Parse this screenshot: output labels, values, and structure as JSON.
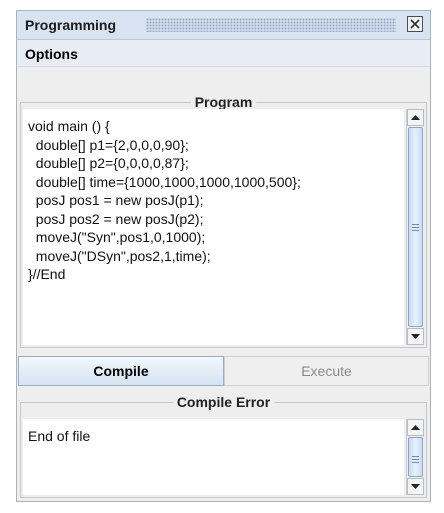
{
  "window": {
    "title": "Programming"
  },
  "menubar": {
    "items": [
      "Options"
    ]
  },
  "program": {
    "group_title": "Program",
    "code": "void main () {\n  double[] p1={2,0,0,0,90};\n  double[] p2={0,0,0,0,87};\n  double[] time={1000,1000,1000,1000,500};\n  posJ pos1 = new posJ(p1);\n  posJ pos2 = new posJ(p2);\n  moveJ(\"Syn\",pos1,0,1000);\n  moveJ(\"DSyn\",pos2,1,time);\n}//End"
  },
  "buttons": {
    "compile": "Compile",
    "execute": "Execute"
  },
  "compile_error": {
    "group_title": "Compile Error",
    "message": "End of file"
  },
  "colors": {
    "titlebar": "#d7e3f1",
    "accent": "#97aec9",
    "background": "#eeeeee"
  },
  "icons": [
    "close-icon",
    "scroll-up-icon",
    "scroll-down-icon"
  ]
}
